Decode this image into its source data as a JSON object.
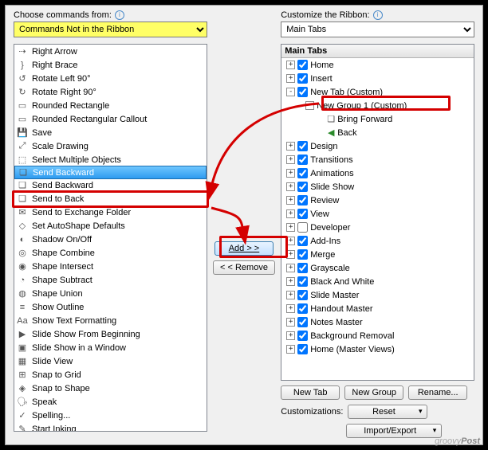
{
  "left": {
    "chooseLabel": "Choose commands from:",
    "comboValue": "Commands Not in the Ribbon",
    "items": [
      {
        "icon": "⇢",
        "label": "Right Arrow"
      },
      {
        "icon": "}",
        "label": "Right Brace"
      },
      {
        "icon": "↺",
        "label": "Rotate Left 90°"
      },
      {
        "icon": "↻",
        "label": "Rotate Right 90°"
      },
      {
        "icon": "▭",
        "label": "Rounded Rectangle"
      },
      {
        "icon": "▭",
        "label": "Rounded Rectangular Callout"
      },
      {
        "icon": "💾",
        "label": "Save"
      },
      {
        "icon": "⤢",
        "label": "Scale Drawing"
      },
      {
        "icon": "⬚",
        "label": "Select Multiple Objects"
      },
      {
        "icon": "❏",
        "label": "Send Backward",
        "sel": true
      },
      {
        "icon": "❏",
        "label": "Send Backward"
      },
      {
        "icon": "❏",
        "label": "Send to Back"
      },
      {
        "icon": "✉",
        "label": "Send to Exchange Folder"
      },
      {
        "icon": "◇",
        "label": "Set AutoShape Defaults"
      },
      {
        "icon": "◐",
        "label": "Shadow On/Off"
      },
      {
        "icon": "◎",
        "label": "Shape Combine"
      },
      {
        "icon": "◉",
        "label": "Shape Intersect"
      },
      {
        "icon": "◔",
        "label": "Shape Subtract"
      },
      {
        "icon": "◍",
        "label": "Shape Union"
      },
      {
        "icon": "≡",
        "label": "Show Outline"
      },
      {
        "icon": "Aa",
        "label": "Show Text Formatting"
      },
      {
        "icon": "▶",
        "label": "Slide Show From Beginning"
      },
      {
        "icon": "▣",
        "label": "Slide Show in a Window"
      },
      {
        "icon": "▦",
        "label": "Slide View"
      },
      {
        "icon": "⊞",
        "label": "Snap to Grid"
      },
      {
        "icon": "◈",
        "label": "Snap to Shape"
      },
      {
        "icon": "🗣",
        "label": "Speak"
      },
      {
        "icon": "✓",
        "label": "Spelling..."
      },
      {
        "icon": "✎",
        "label": "Start Inking"
      }
    ]
  },
  "mid": {
    "addLabel": "Add > >",
    "removeLabel": "< < Remove"
  },
  "right": {
    "customizeLabel": "Customize the Ribbon:",
    "comboValue": "Main Tabs",
    "treeHeader": "Main Tabs",
    "nodes": [
      {
        "exp": "+",
        "chk": true,
        "label": "Home",
        "pad": 6
      },
      {
        "exp": "+",
        "chk": true,
        "label": "Insert",
        "pad": 6
      },
      {
        "exp": "-",
        "chk": true,
        "label": "New Tab (Custom)",
        "pad": 6
      },
      {
        "exp": "-",
        "label": "New Group 1 (Custom)",
        "pad": 30,
        "box": true
      },
      {
        "icon": "❏",
        "label": "Bring Forward",
        "pad": 54
      },
      {
        "icon": "◀",
        "iconColor": "#2a8a2a",
        "label": "Back",
        "pad": 54
      },
      {
        "exp": "+",
        "chk": true,
        "label": "Design",
        "pad": 6
      },
      {
        "exp": "+",
        "chk": true,
        "label": "Transitions",
        "pad": 6
      },
      {
        "exp": "+",
        "chk": true,
        "label": "Animations",
        "pad": 6
      },
      {
        "exp": "+",
        "chk": true,
        "label": "Slide Show",
        "pad": 6
      },
      {
        "exp": "+",
        "chk": true,
        "label": "Review",
        "pad": 6
      },
      {
        "exp": "+",
        "chk": true,
        "label": "View",
        "pad": 6
      },
      {
        "exp": "+",
        "chk": false,
        "label": "Developer",
        "pad": 6
      },
      {
        "exp": "+",
        "chk": true,
        "label": "Add-Ins",
        "pad": 6
      },
      {
        "exp": "+",
        "chk": true,
        "label": "Merge",
        "pad": 6
      },
      {
        "exp": "+",
        "chk": true,
        "label": "Grayscale",
        "pad": 6
      },
      {
        "exp": "+",
        "chk": true,
        "label": "Black And White",
        "pad": 6
      },
      {
        "exp": "+",
        "chk": true,
        "label": "Slide Master",
        "pad": 6
      },
      {
        "exp": "+",
        "chk": true,
        "label": "Handout Master",
        "pad": 6
      },
      {
        "exp": "+",
        "chk": true,
        "label": "Notes Master",
        "pad": 6
      },
      {
        "exp": "+",
        "chk": true,
        "label": "Background Removal",
        "pad": 6
      },
      {
        "exp": "+",
        "chk": true,
        "label": "Home (Master Views)",
        "pad": 6
      }
    ],
    "newTab": "New Tab",
    "newGroup": "New Group",
    "rename": "Rename...",
    "customizations": "Customizations:",
    "reset": "Reset",
    "importExport": "Import/Export"
  },
  "watermark": {
    "a": "groovy",
    "b": "Post"
  }
}
